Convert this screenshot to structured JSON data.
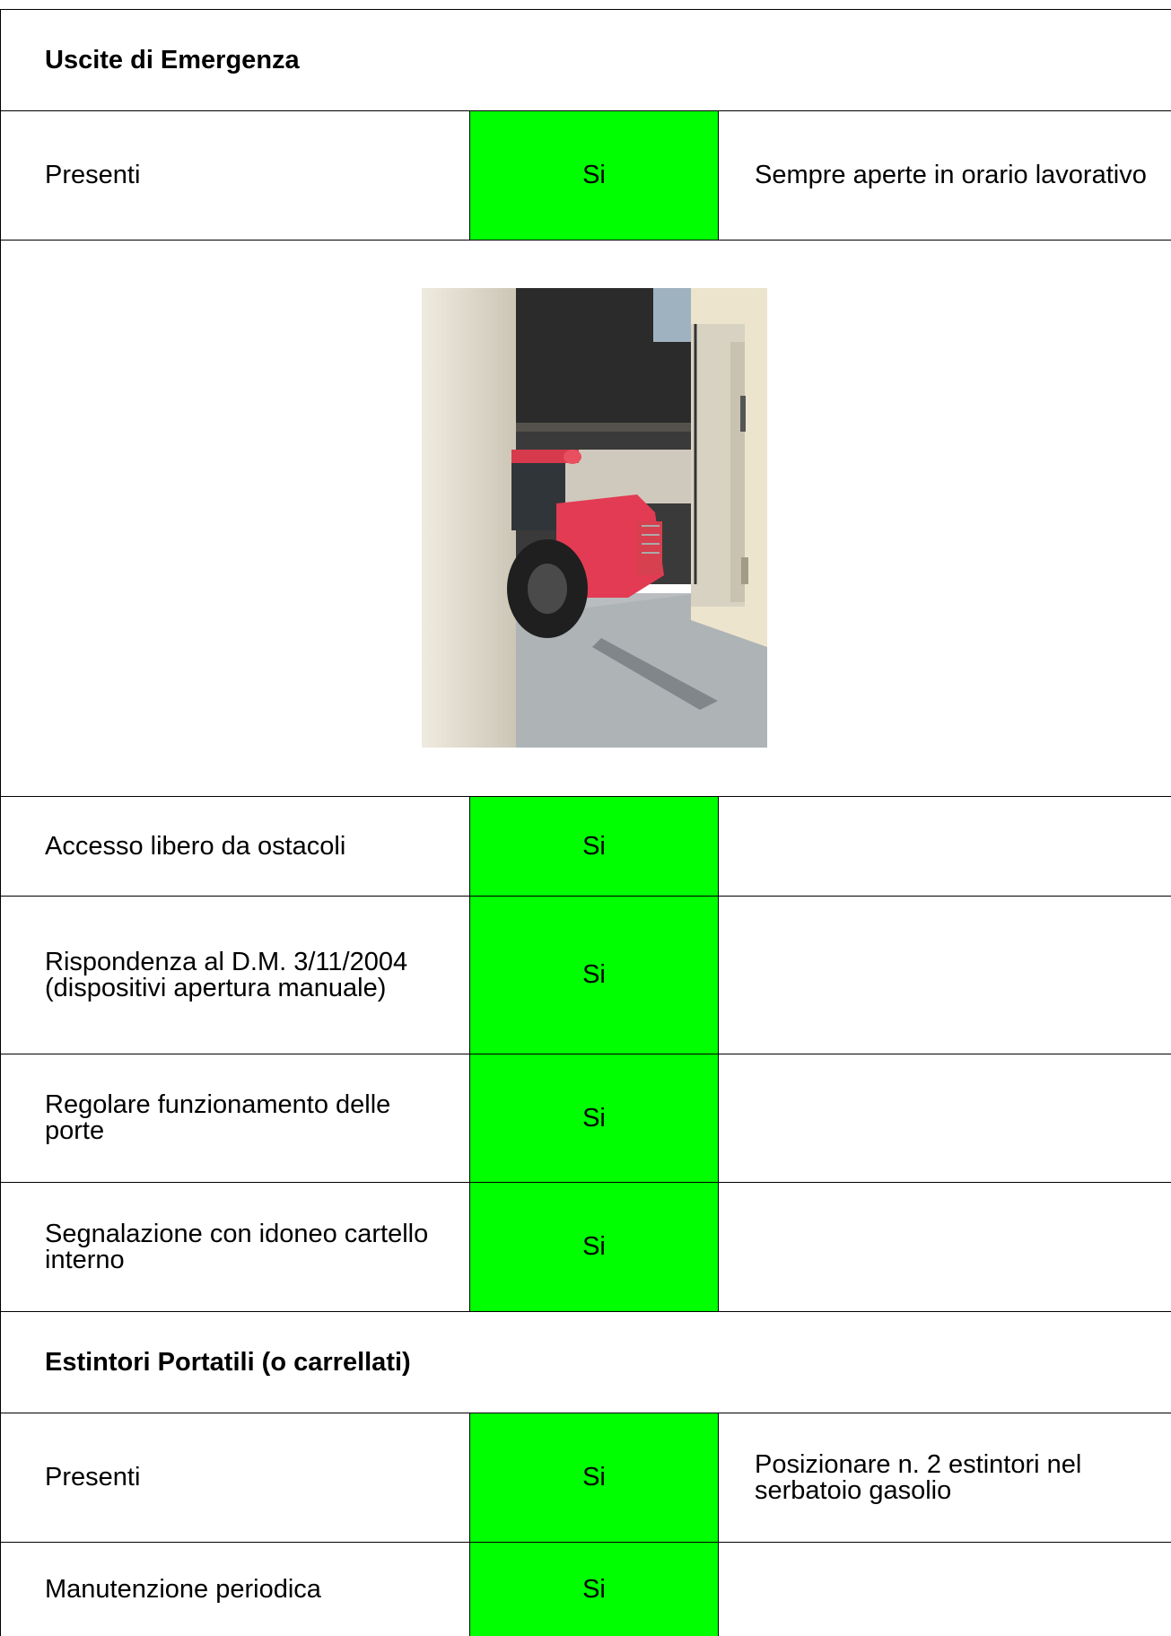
{
  "sections": [
    {
      "title": "Uscite di Emergenza",
      "rows": [
        {
          "label": "Presenti",
          "value": "Si",
          "note": "Sempre aperte in orario lavorativo"
        }
      ],
      "rows_after_photo": [
        {
          "label": "Accesso libero da ostacoli",
          "value": "Si",
          "note": ""
        },
        {
          "label": "Rispondenza al D.M. 3/11/2004 (dispositivi apertura manuale)",
          "value": "Si",
          "note": ""
        },
        {
          "label": "Regolare funzionamento delle porte",
          "value": "Si",
          "note": ""
        },
        {
          "label": "Segnalazione con idoneo cartello interno",
          "value": "Si",
          "note": ""
        }
      ]
    },
    {
      "title": "Estintori Portatili (o carrellati)",
      "rows": [
        {
          "label": "Presenti",
          "value": "Si",
          "note": "Posizionare n. 2 estintori nel serbatoio gasolio"
        },
        {
          "label": "Manutenzione periodica",
          "value": "Si",
          "note": ""
        }
      ]
    }
  ],
  "colors": {
    "ok_fill": "#00ff00",
    "border": "#000000"
  }
}
